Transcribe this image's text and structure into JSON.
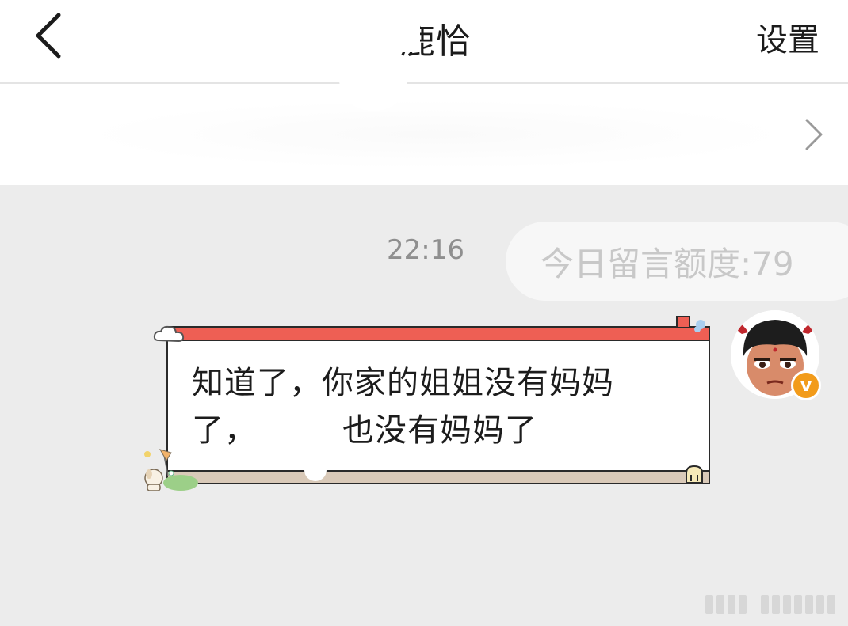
{
  "header": {
    "title": "鹿恰",
    "settings_label": "设置",
    "back_icon": "back-chevron-icon"
  },
  "banner": {
    "chevron_icon": "chevron-right-icon"
  },
  "chat": {
    "timestamp": "22:16",
    "quota_label": "今日留言额度:79",
    "message_line1": "知道了，你家的姐姐没有妈妈",
    "message_line2": "了，",
    "message_line2_rest": "也没有妈妈了"
  },
  "colors": {
    "bubble_top": "#ee5f54",
    "bubble_bottom": "#d9c9b8",
    "verify_badge": "#f29b1a"
  }
}
